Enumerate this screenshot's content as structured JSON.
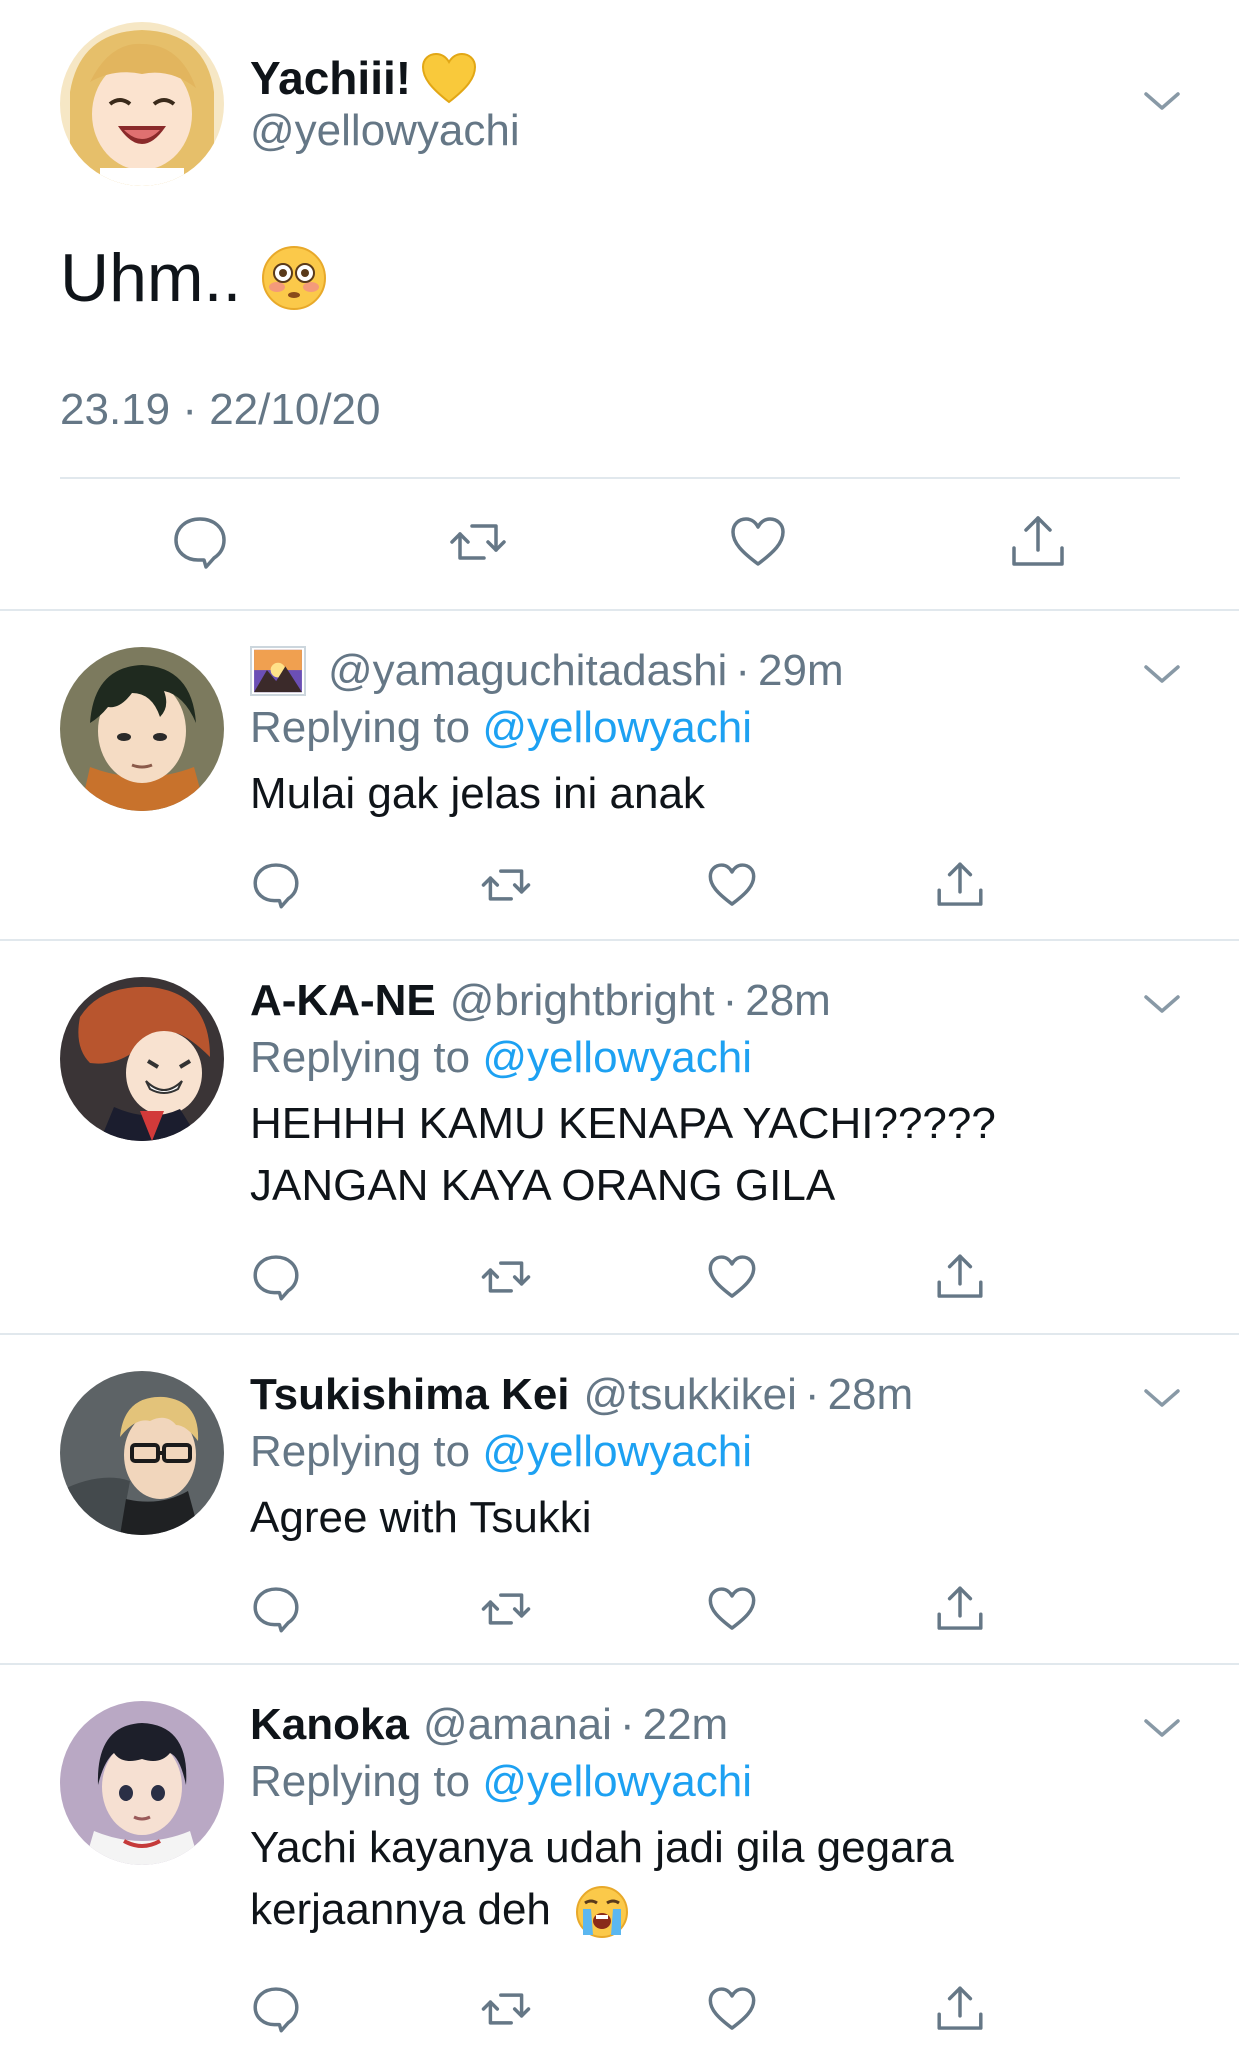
{
  "main_tweet": {
    "name": "Yachiii!",
    "name_emoji": "yellow-heart-icon",
    "handle": "@yellowyachi",
    "text": "Uhm..",
    "text_emoji": "flushed-face-icon",
    "timestamp": "23.19 · 22/10/20",
    "actions": [
      "reply-icon",
      "retweet-icon",
      "like-icon",
      "share-icon"
    ]
  },
  "replies": [
    {
      "name": "",
      "name_icon": "image-flag-icon",
      "handle": "@yamaguchitadashi",
      "dot": "·",
      "time": "29m",
      "replying_prefix": "Replying to",
      "replying_mention": "@yellowyachi",
      "text_lines": [
        "Mulai gak jelas ini anak"
      ]
    },
    {
      "name": "A-KA-NE",
      "handle": "@brightbright",
      "dot": "·",
      "time": "28m",
      "replying_prefix": "Replying to",
      "replying_mention": "@yellowyachi",
      "text_lines": [
        "HEHHH KAMU KENAPA YACHI?????",
        "JANGAN KAYA ORANG GILA"
      ]
    },
    {
      "name": "Tsukishima Kei",
      "handle": "@tsukkikei",
      "dot": "·",
      "time": "28m",
      "replying_prefix": "Replying to",
      "replying_mention": "@yellowyachi",
      "text_lines": [
        "Agree with Tsukki"
      ]
    },
    {
      "name": "Kanoka",
      "handle": "@amanai",
      "dot": "·",
      "time": "22m",
      "replying_prefix": "Replying to",
      "replying_mention": "@yellowyachi",
      "text_lines": [
        "Yachi kayanya udah jadi gila gegara",
        "kerjaannya deh"
      ],
      "text_emoji": "loudly-crying-face-icon"
    }
  ],
  "colors": {
    "text": "#0f1419",
    "secondary": "#657786",
    "link": "#1da1f2",
    "divider": "#e1e8ed",
    "icon": "#657786"
  }
}
